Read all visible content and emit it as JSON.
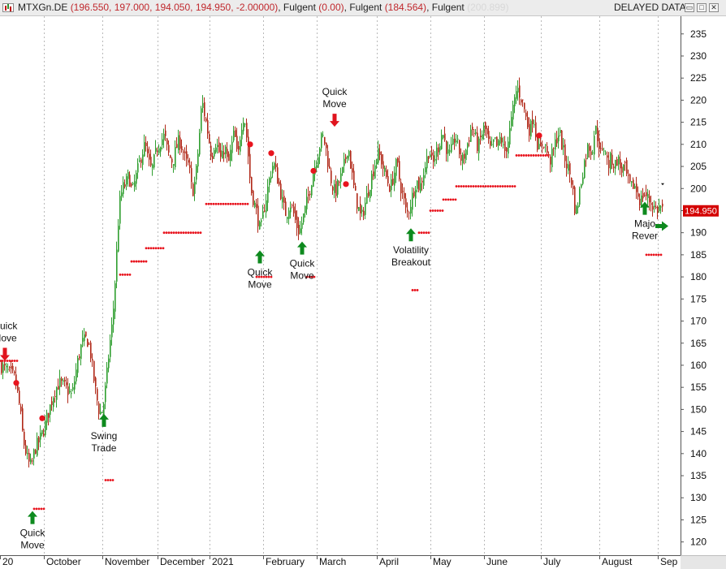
{
  "window": {
    "symbol": "MTXGn.DE",
    "ohlc": "(196.550, 197.000, 194.050, 194.950, -2.00000)",
    "ind1_name": "Fulgent",
    "ind1_value": "(0.00)",
    "ind2_name": "Fulgent",
    "ind2_value": "(184.564)",
    "ind3_name": "Fulgent",
    "ind3_value": "(200.899)",
    "status": "DELAYED DATA",
    "minimize_glyph": "▭",
    "maximize_glyph": "□",
    "close_glyph": "✕"
  },
  "colors": {
    "up": "#2f9e2f",
    "down": "#b02818",
    "stop_dots": "#e8141e",
    "buy_arrow": "#0e8a1e",
    "sell_arrow": "#e0141e",
    "price_tag_bg": "#d40000",
    "grid": "#b9b9b9"
  },
  "chart_data": {
    "type": "candlestick",
    "x_ticks": [
      "20",
      "October",
      "November",
      "December",
      "2021",
      "February",
      "March",
      "April",
      "May",
      "June",
      "July",
      "August",
      "Sep"
    ],
    "y_ticks": [
      120,
      125,
      130,
      135,
      140,
      145,
      150,
      155,
      160,
      165,
      170,
      175,
      180,
      185,
      190,
      195,
      200,
      205,
      210,
      215,
      220,
      225,
      230,
      235
    ],
    "ylim": [
      117,
      239
    ],
    "last_price": "194.950",
    "close_path": [
      [
        0,
        160
      ],
      [
        6,
        159
      ],
      [
        12,
        158
      ],
      [
        18,
        157
      ],
      [
        24,
        150
      ],
      [
        28,
        143
      ],
      [
        34,
        138
      ],
      [
        38,
        137
      ],
      [
        42,
        141
      ],
      [
        48,
        143
      ],
      [
        54,
        146
      ],
      [
        60,
        150
      ],
      [
        66,
        154
      ],
      [
        72,
        156
      ],
      [
        80,
        155
      ],
      [
        88,
        153
      ],
      [
        94,
        160
      ],
      [
        100,
        165
      ],
      [
        106,
        166
      ],
      [
        110,
        164
      ],
      [
        114,
        158
      ],
      [
        118,
        153
      ],
      [
        122,
        149
      ],
      [
        126,
        150
      ],
      [
        130,
        156
      ],
      [
        134,
        164
      ],
      [
        138,
        170
      ],
      [
        142,
        182
      ],
      [
        146,
        196
      ],
      [
        150,
        200
      ],
      [
        154,
        201
      ],
      [
        158,
        203
      ],
      [
        162,
        199
      ],
      [
        166,
        202
      ],
      [
        170,
        205
      ],
      [
        174,
        208
      ],
      [
        178,
        210
      ],
      [
        182,
        206
      ],
      [
        186,
        204
      ],
      [
        190,
        207
      ],
      [
        194,
        210
      ],
      [
        198,
        211
      ],
      [
        202,
        212
      ],
      [
        206,
        208
      ],
      [
        212,
        206
      ],
      [
        216,
        209
      ],
      [
        220,
        211
      ],
      [
        224,
        209
      ],
      [
        228,
        206
      ],
      [
        232,
        205
      ],
      [
        236,
        199
      ],
      [
        240,
        202
      ],
      [
        244,
        210
      ],
      [
        248,
        220
      ],
      [
        252,
        216
      ],
      [
        256,
        212
      ],
      [
        260,
        207
      ],
      [
        264,
        211
      ],
      [
        268,
        209
      ],
      [
        272,
        206
      ],
      [
        276,
        210
      ],
      [
        280,
        205
      ],
      [
        284,
        209
      ],
      [
        288,
        213
      ],
      [
        292,
        206
      ],
      [
        296,
        214
      ],
      [
        300,
        217
      ],
      [
        304,
        210
      ],
      [
        308,
        200
      ],
      [
        312,
        197
      ],
      [
        316,
        194
      ],
      [
        320,
        190
      ],
      [
        324,
        195
      ],
      [
        328,
        199
      ],
      [
        332,
        203
      ],
      [
        336,
        206
      ],
      [
        340,
        203
      ],
      [
        344,
        200
      ],
      [
        348,
        196
      ],
      [
        352,
        194
      ],
      [
        356,
        197
      ],
      [
        360,
        195
      ],
      [
        364,
        192
      ],
      [
        368,
        190
      ],
      [
        372,
        193
      ],
      [
        376,
        196
      ],
      [
        380,
        199
      ],
      [
        384,
        203
      ],
      [
        388,
        206
      ],
      [
        392,
        209
      ],
      [
        396,
        212
      ],
      [
        400,
        210
      ],
      [
        404,
        205
      ],
      [
        408,
        201
      ],
      [
        412,
        199
      ],
      [
        416,
        201
      ],
      [
        420,
        203
      ],
      [
        424,
        206
      ],
      [
        428,
        210
      ],
      [
        432,
        204
      ],
      [
        436,
        199
      ],
      [
        440,
        196
      ],
      [
        444,
        193
      ],
      [
        448,
        196
      ],
      [
        452,
        199
      ],
      [
        456,
        202
      ],
      [
        460,
        205
      ],
      [
        464,
        208
      ],
      [
        468,
        207
      ],
      [
        472,
        204
      ],
      [
        476,
        202
      ],
      [
        480,
        200
      ],
      [
        484,
        203
      ],
      [
        488,
        206
      ],
      [
        492,
        201
      ],
      [
        496,
        198
      ],
      [
        500,
        194
      ],
      [
        504,
        196
      ],
      [
        508,
        199
      ],
      [
        512,
        202
      ],
      [
        516,
        200
      ],
      [
        520,
        203
      ],
      [
        524,
        206
      ],
      [
        528,
        209
      ],
      [
        532,
        205
      ],
      [
        536,
        208
      ],
      [
        540,
        210
      ],
      [
        544,
        213
      ],
      [
        548,
        210
      ],
      [
        552,
        207
      ],
      [
        556,
        209
      ],
      [
        560,
        212
      ],
      [
        564,
        209
      ],
      [
        568,
        206
      ],
      [
        572,
        208
      ],
      [
        576,
        211
      ],
      [
        580,
        214
      ],
      [
        584,
        212
      ],
      [
        588,
        209
      ],
      [
        592,
        212
      ],
      [
        596,
        214
      ],
      [
        600,
        211
      ],
      [
        604,
        208
      ],
      [
        608,
        211
      ],
      [
        612,
        209
      ],
      [
        616,
        212
      ],
      [
        620,
        208
      ],
      [
        624,
        210
      ],
      [
        628,
        214
      ],
      [
        632,
        219
      ],
      [
        636,
        223
      ],
      [
        640,
        221
      ],
      [
        644,
        219
      ],
      [
        648,
        215
      ],
      [
        652,
        213
      ],
      [
        656,
        217
      ],
      [
        660,
        211
      ],
      [
        664,
        208
      ],
      [
        668,
        211
      ],
      [
        672,
        209
      ],
      [
        676,
        206
      ],
      [
        680,
        208
      ],
      [
        684,
        211
      ],
      [
        688,
        213
      ],
      [
        692,
        209
      ],
      [
        696,
        206
      ],
      [
        700,
        204
      ],
      [
        704,
        201
      ],
      [
        708,
        194
      ],
      [
        712,
        198
      ],
      [
        716,
        203
      ],
      [
        720,
        207
      ],
      [
        724,
        210
      ],
      [
        728,
        208
      ],
      [
        732,
        214
      ],
      [
        736,
        211
      ],
      [
        740,
        207
      ],
      [
        744,
        210
      ],
      [
        748,
        205
      ],
      [
        752,
        207
      ],
      [
        756,
        205
      ],
      [
        760,
        207
      ],
      [
        764,
        204
      ],
      [
        768,
        205
      ],
      [
        772,
        202
      ],
      [
        776,
        200
      ],
      [
        780,
        201
      ],
      [
        784,
        199
      ],
      [
        788,
        197
      ],
      [
        792,
        199
      ],
      [
        796,
        198
      ],
      [
        800,
        197
      ],
      [
        804,
        196
      ],
      [
        808,
        195
      ],
      [
        812,
        196
      ],
      [
        816,
        195
      ]
    ],
    "stop_segments": [
      [
        0,
        22,
        161
      ],
      [
        42,
        56,
        127.5
      ],
      [
        130,
        140,
        134
      ],
      [
        148,
        160,
        180.5
      ],
      [
        162,
        180,
        183.5
      ],
      [
        180,
        202,
        186.5
      ],
      [
        202,
        248,
        190
      ],
      [
        254,
        306,
        196.5
      ],
      [
        316,
        336,
        180
      ],
      [
        378,
        388,
        180
      ],
      [
        508,
        516,
        177
      ],
      [
        516,
        530,
        190
      ],
      [
        530,
        546,
        195
      ],
      [
        546,
        562,
        197.5
      ],
      [
        562,
        636,
        200.5
      ],
      [
        636,
        676,
        207.5
      ],
      [
        796,
        816,
        185
      ]
    ],
    "stop_points": [
      [
        20,
        156
      ],
      [
        52,
        148
      ],
      [
        308,
        210
      ],
      [
        334,
        208
      ],
      [
        386,
        204
      ],
      [
        426,
        201
      ],
      [
        664,
        212
      ]
    ],
    "signals": [
      {
        "dir": "down",
        "x": 6,
        "y": 161,
        "label": [
          "Quick",
          "Move"
        ]
      },
      {
        "dir": "up",
        "x": 40,
        "y": 127,
        "label": [
          "Quick",
          "Move"
        ]
      },
      {
        "dir": "up",
        "x": 128,
        "y": 149,
        "label": [
          "Swing",
          "Trade"
        ]
      },
      {
        "dir": "up",
        "x": 320,
        "y": 186,
        "label": [
          "Quick",
          "Move"
        ]
      },
      {
        "dir": "up",
        "x": 372,
        "y": 188,
        "label": [
          "Quick",
          "Move"
        ]
      },
      {
        "dir": "down",
        "x": 412,
        "y": 214,
        "label": [
          "Quick",
          "Move"
        ]
      },
      {
        "dir": "up",
        "x": 506,
        "y": 191,
        "label": [
          "Volatility",
          "Breakout"
        ]
      },
      {
        "dir": "up",
        "x": 794,
        "y": 197,
        "label": [
          "Majo",
          "Rever"
        ]
      }
    ]
  }
}
